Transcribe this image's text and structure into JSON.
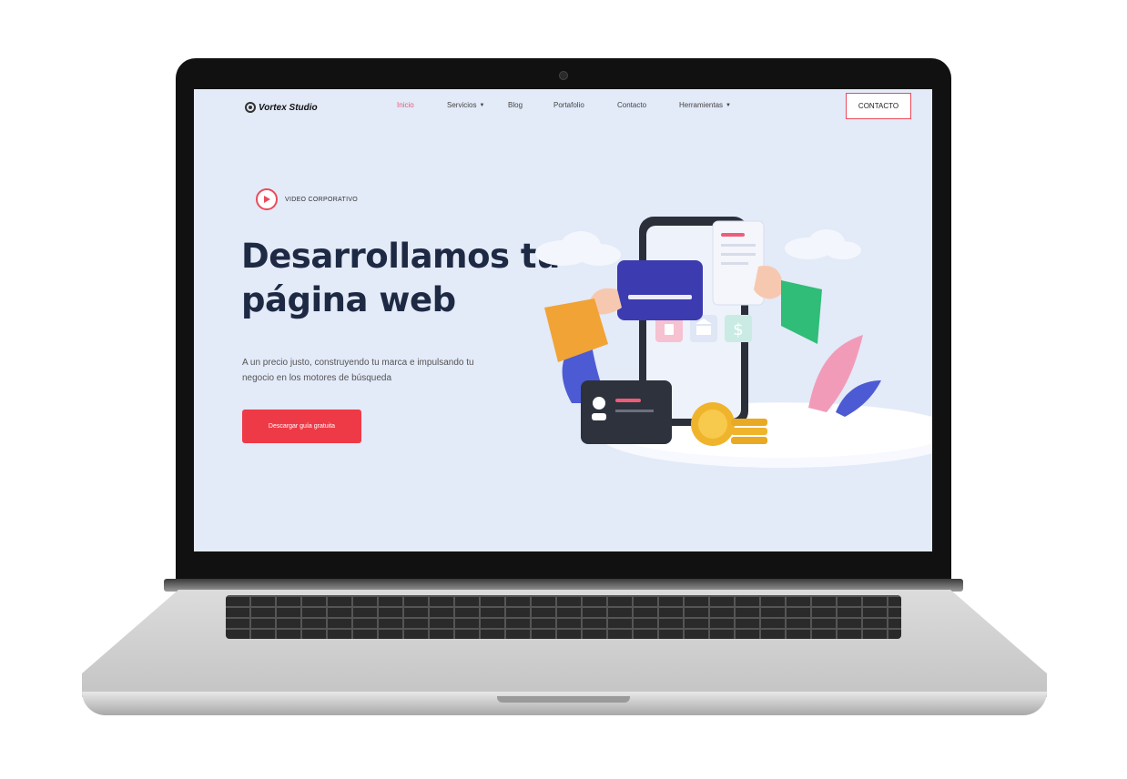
{
  "site": {
    "logo_text": "Vortex Studio",
    "nav": [
      {
        "label": "Inicio",
        "active": true
      },
      {
        "label": "Servicios",
        "dropdown": true
      },
      {
        "label": "Blog"
      },
      {
        "label": "Portafolio"
      },
      {
        "label": "Contacto"
      },
      {
        "label": "Herramientas",
        "dropdown": true
      }
    ],
    "contact_button": "CONTACTO"
  },
  "hero": {
    "video_label": "VIDEO CORPORATIVO",
    "title_line1": "Desarrollamos tu",
    "title_line2": "página web",
    "subtitle_line1": "A un precio justo, construyendo tu marca e impulsando tu",
    "subtitle_line2": "negocio en los motores de búsqueda",
    "cta_label": "Descargar guía gratuita"
  },
  "colors": {
    "accent": "#ee3a47",
    "nav_active": "#e85b78",
    "screen_bg": "#e3eaf8",
    "title": "#1e2a44"
  },
  "icons": [
    "play-icon",
    "lock-icon",
    "bank-icon",
    "dollar-icon",
    "user-icon",
    "coin-icon"
  ]
}
